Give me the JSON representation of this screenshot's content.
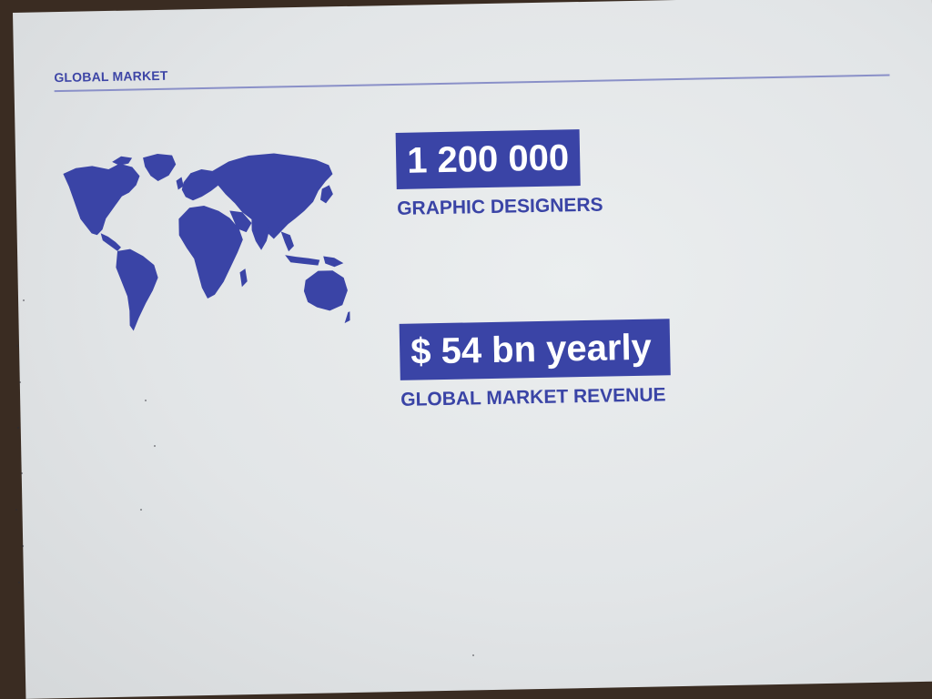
{
  "slide": {
    "title": "GLOBAL MARKET",
    "accent_color": "#3a44a6",
    "background_color": "#e6e9ea",
    "map_icon": "world-map-icon"
  },
  "stats": [
    {
      "value": "1 200 000",
      "caption": "GRAPHIC DESIGNERS"
    },
    {
      "value": "$ 54 bn yearly",
      "caption": "GLOBAL MARKET REVENUE"
    }
  ]
}
